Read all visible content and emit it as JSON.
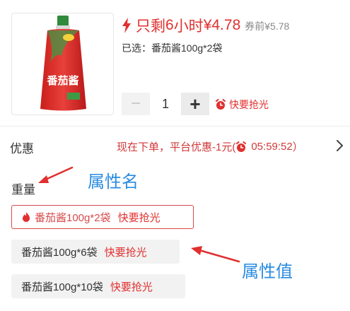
{
  "product": {
    "image_label": "番茄酱"
  },
  "price": {
    "prefix": "只剩",
    "hours": "6",
    "hours_unit": "小时",
    "currency": "¥",
    "amount": "4.78",
    "original_label": "券前¥5.78"
  },
  "selected": {
    "label": "已选：番茄酱100g*2袋"
  },
  "quantity": {
    "minus": "−",
    "value": "1",
    "plus": "+",
    "flash_label": "快要抢光"
  },
  "promo": {
    "label": "优惠",
    "text": "现在下单，平台优惠-1元(",
    "countdown": "05:59:52",
    "close_paren": "）"
  },
  "attribute": {
    "name": "重量",
    "options": [
      {
        "label": "番茄酱100g*2袋",
        "flash": "快要抢光",
        "selected": true
      },
      {
        "label": "番茄酱100g*6袋",
        "flash": "快要抢光",
        "selected": false
      },
      {
        "label": "番茄酱100g*10袋",
        "flash": "快要抢光",
        "selected": false
      }
    ]
  },
  "annotations": {
    "attr_name_note": "属性名",
    "attr_value_note": "属性值"
  },
  "colors": {
    "accent_red": "#e0302f",
    "note_blue": "#2a8ce0",
    "chip_bg": "#f2f2f2"
  }
}
